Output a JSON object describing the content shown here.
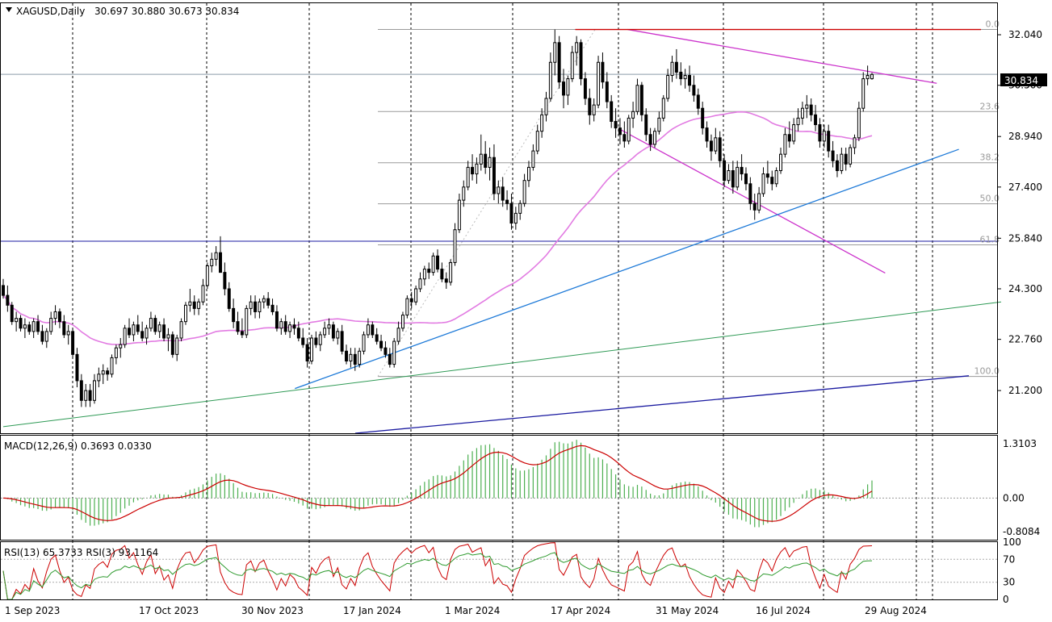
{
  "main_header": {
    "title": "XAGUSD,Daily",
    "ohlc": "30.697 30.880 30.673 30.834"
  },
  "macd_header": "MACD(12,26,9) 0.3693 0.0330",
  "rsi_header": "RSI(13) 65.3733  RSI(3) 93.1164",
  "price_box": "30.834",
  "colors": {
    "bull": "#000000",
    "ma": "#e27be2",
    "magenta_line": "#cc33cc",
    "red_line": "#cc0000",
    "blue_trend": "#1e7ad8",
    "green_trend": "#2e9a55",
    "navy_trend": "#1a1aa0",
    "macd_hist": "#4caf50",
    "macd_signal": "#cc0000",
    "rsi_fast": "#cc0000",
    "rsi_slow": "#2e9a2e"
  },
  "chart_data": [
    {
      "type": "candlestick",
      "symbol": "XAGUSD",
      "timeframe": "Daily",
      "x_ticks": [
        "1 Sep 2023",
        "17 Oct 2023",
        "30 Nov 2023",
        "17 Jan 2024",
        "1 Mar 2024",
        "17 Apr 2024",
        "31 May 2024",
        "16 Jul 2024",
        "29 Aug 2024"
      ],
      "y_ticks": [
        32.04,
        30.5,
        28.94,
        27.4,
        25.84,
        24.3,
        22.76,
        21.2
      ],
      "ylim": [
        19.9,
        33.0
      ],
      "last_price": 30.834,
      "fib_levels": [
        {
          "label": "0.0",
          "value": 32.2
        },
        {
          "label": "23.6",
          "value": 29.7
        },
        {
          "label": "38.2",
          "value": 28.14
        },
        {
          "label": "50.0",
          "value": 26.89
        },
        {
          "label": "61.8",
          "value": 25.64
        },
        {
          "label": "100.0",
          "value": 21.63
        }
      ],
      "trendlines": [
        {
          "name": "magenta-upper",
          "p1": {
            "date": "2024-05-20",
            "price": 32.2
          },
          "p2": {
            "date": "2024-09-18",
            "price": 30.56
          }
        },
        {
          "name": "magenta-lower",
          "p1": {
            "date": "2024-05-17",
            "price": 29.15
          },
          "p2": {
            "date": "2024-09-04",
            "price": 24.78
          }
        },
        {
          "name": "red-resistance",
          "p1": {
            "date": "2024-04-28",
            "price": 32.2
          },
          "p2": {
            "date": "2024-09-30",
            "price": 32.2
          }
        },
        {
          "name": "blue-support",
          "p1": {
            "date": "2023-12-26",
            "price": 21.26
          },
          "p2": {
            "date": "2024-09-24",
            "price": 28.55
          }
        }
      ],
      "ohlc": [
        [
          24.4,
          24.6,
          24.0,
          24.1
        ],
        [
          24.1,
          24.4,
          23.6,
          23.8
        ],
        [
          23.8,
          23.9,
          23.2,
          23.3
        ],
        [
          23.3,
          23.6,
          23.0,
          23.4
        ],
        [
          23.4,
          23.5,
          23.0,
          23.1
        ],
        [
          23.1,
          23.4,
          22.8,
          23.2
        ],
        [
          23.2,
          23.3,
          22.9,
          23.0
        ],
        [
          23.0,
          23.4,
          22.8,
          23.3
        ],
        [
          23.3,
          23.5,
          22.9,
          23.0
        ],
        [
          23.0,
          23.2,
          22.6,
          22.7
        ],
        [
          22.7,
          23.1,
          22.5,
          23.0
        ],
        [
          23.0,
          23.6,
          22.9,
          23.4
        ],
        [
          23.4,
          23.8,
          23.2,
          23.6
        ],
        [
          23.6,
          23.7,
          23.1,
          23.3
        ],
        [
          23.3,
          23.5,
          22.8,
          22.9
        ],
        [
          22.9,
          23.2,
          22.6,
          23.0
        ],
        [
          23.0,
          23.1,
          22.2,
          22.3
        ],
        [
          22.3,
          22.5,
          21.3,
          21.5
        ],
        [
          21.5,
          21.7,
          20.7,
          20.9
        ],
        [
          20.9,
          21.4,
          20.7,
          21.2
        ],
        [
          21.2,
          21.4,
          20.7,
          20.9
        ],
        [
          20.9,
          21.7,
          20.8,
          21.5
        ],
        [
          21.5,
          21.9,
          21.3,
          21.7
        ],
        [
          21.7,
          22.0,
          21.4,
          21.8
        ],
        [
          21.8,
          21.9,
          21.5,
          21.7
        ],
        [
          21.7,
          22.3,
          21.6,
          22.2
        ],
        [
          22.2,
          22.6,
          22.0,
          22.5
        ],
        [
          22.5,
          22.8,
          22.2,
          22.6
        ],
        [
          22.6,
          23.2,
          22.5,
          23.1
        ],
        [
          23.1,
          23.4,
          22.8,
          22.9
        ],
        [
          22.9,
          23.3,
          22.7,
          23.2
        ],
        [
          23.2,
          23.5,
          22.9,
          23.0
        ],
        [
          23.0,
          23.3,
          22.7,
          22.8
        ],
        [
          22.8,
          23.2,
          22.6,
          23.1
        ],
        [
          23.1,
          23.6,
          23.0,
          23.4
        ],
        [
          23.4,
          23.5,
          22.9,
          23.0
        ],
        [
          23.0,
          23.3,
          22.8,
          23.2
        ],
        [
          23.2,
          23.4,
          22.7,
          22.8
        ],
        [
          22.8,
          23.1,
          22.4,
          22.9
        ],
        [
          22.9,
          23.0,
          22.2,
          22.3
        ],
        [
          22.3,
          22.9,
          22.1,
          22.8
        ],
        [
          22.8,
          23.4,
          22.7,
          23.3
        ],
        [
          23.3,
          23.9,
          23.2,
          23.8
        ],
        [
          23.8,
          24.3,
          23.6,
          23.9
        ],
        [
          23.9,
          24.1,
          23.5,
          23.7
        ],
        [
          23.7,
          24.0,
          23.5,
          23.9
        ],
        [
          23.9,
          24.6,
          23.8,
          24.4
        ],
        [
          24.4,
          25.1,
          24.3,
          25.0
        ],
        [
          25.0,
          25.4,
          24.8,
          25.2
        ],
        [
          25.2,
          25.6,
          25.0,
          25.4
        ],
        [
          25.4,
          25.9,
          25.1,
          24.8
        ],
        [
          24.8,
          25.1,
          24.1,
          24.3
        ],
        [
          24.3,
          24.5,
          23.6,
          23.7
        ],
        [
          23.7,
          24.0,
          23.1,
          23.3
        ],
        [
          23.3,
          23.6,
          22.9,
          23.0
        ],
        [
          23.0,
          23.4,
          22.8,
          22.9
        ],
        [
          22.9,
          23.8,
          22.8,
          23.7
        ],
        [
          23.7,
          24.1,
          23.5,
          23.9
        ],
        [
          23.9,
          24.1,
          23.4,
          23.6
        ],
        [
          23.6,
          24.0,
          23.4,
          23.9
        ],
        [
          23.9,
          24.1,
          23.7,
          24.0
        ],
        [
          24.0,
          24.2,
          23.7,
          23.8
        ],
        [
          23.8,
          24.0,
          23.5,
          23.6
        ],
        [
          23.6,
          23.8,
          23.0,
          23.1
        ],
        [
          23.1,
          23.4,
          22.9,
          23.3
        ],
        [
          23.3,
          23.5,
          22.9,
          23.0
        ],
        [
          23.0,
          23.3,
          22.8,
          23.2
        ],
        [
          23.2,
          23.4,
          22.9,
          23.1
        ],
        [
          23.1,
          23.3,
          22.7,
          22.8
        ],
        [
          22.8,
          23.1,
          22.5,
          22.6
        ],
        [
          22.6,
          22.8,
          21.9,
          22.1
        ],
        [
          22.1,
          22.9,
          22.0,
          22.8
        ],
        [
          22.8,
          23.0,
          22.5,
          22.6
        ],
        [
          22.6,
          23.0,
          22.4,
          22.9
        ],
        [
          22.9,
          23.3,
          22.8,
          23.1
        ],
        [
          23.1,
          23.4,
          22.9,
          23.2
        ],
        [
          23.2,
          23.3,
          22.7,
          22.8
        ],
        [
          22.8,
          23.1,
          22.6,
          23.0
        ],
        [
          23.0,
          23.2,
          22.3,
          22.4
        ],
        [
          22.4,
          22.6,
          22.0,
          22.1
        ],
        [
          22.1,
          22.5,
          21.9,
          22.3
        ],
        [
          22.3,
          22.5,
          21.8,
          22.0
        ],
        [
          22.0,
          22.5,
          21.9,
          22.4
        ],
        [
          22.4,
          23.0,
          22.3,
          22.9
        ],
        [
          22.9,
          23.4,
          22.8,
          23.2
        ],
        [
          23.2,
          23.3,
          22.8,
          22.9
        ],
        [
          22.9,
          23.1,
          22.6,
          22.7
        ],
        [
          22.7,
          22.9,
          22.4,
          22.5
        ],
        [
          22.5,
          22.7,
          22.2,
          22.3
        ],
        [
          22.3,
          22.5,
          21.9,
          22.0
        ],
        [
          22.0,
          22.8,
          21.9,
          22.7
        ],
        [
          22.7,
          23.3,
          22.6,
          23.1
        ],
        [
          23.1,
          23.6,
          23.0,
          23.5
        ],
        [
          23.5,
          24.1,
          23.4,
          24.0
        ],
        [
          24.0,
          24.2,
          23.7,
          23.9
        ],
        [
          23.9,
          24.4,
          23.8,
          24.3
        ],
        [
          24.3,
          24.8,
          24.2,
          24.6
        ],
        [
          24.6,
          25.0,
          24.4,
          24.9
        ],
        [
          24.9,
          25.1,
          24.6,
          24.8
        ],
        [
          24.8,
          25.4,
          24.7,
          25.3
        ],
        [
          25.3,
          25.5,
          24.8,
          24.9
        ],
        [
          24.9,
          25.1,
          24.5,
          24.6
        ],
        [
          24.6,
          24.8,
          24.3,
          24.5
        ],
        [
          24.5,
          25.2,
          24.4,
          25.1
        ],
        [
          25.1,
          26.3,
          25.0,
          26.1
        ],
        [
          26.1,
          27.2,
          26.0,
          27.0
        ],
        [
          27.0,
          27.6,
          26.8,
          27.4
        ],
        [
          27.4,
          28.2,
          27.3,
          28.0
        ],
        [
          28.0,
          28.4,
          27.6,
          27.8
        ],
        [
          27.8,
          28.3,
          27.5,
          28.1
        ],
        [
          28.1,
          29.0,
          27.9,
          28.4
        ],
        [
          28.4,
          28.8,
          27.8,
          28.0
        ],
        [
          28.0,
          28.6,
          27.6,
          28.3
        ],
        [
          28.3,
          28.7,
          27.0,
          27.2
        ],
        [
          27.2,
          27.6,
          26.9,
          27.4
        ],
        [
          27.4,
          27.7,
          26.8,
          27.0
        ],
        [
          27.0,
          27.3,
          26.7,
          26.9
        ],
        [
          26.9,
          27.2,
          26.1,
          26.3
        ],
        [
          26.3,
          26.8,
          26.1,
          26.6
        ],
        [
          26.6,
          27.0,
          26.4,
          26.9
        ],
        [
          26.9,
          27.8,
          26.8,
          27.6
        ],
        [
          27.6,
          28.2,
          27.4,
          28.0
        ],
        [
          28.0,
          28.7,
          27.9,
          28.5
        ],
        [
          28.5,
          29.3,
          28.4,
          29.1
        ],
        [
          29.1,
          29.8,
          28.9,
          29.6
        ],
        [
          29.6,
          30.3,
          29.4,
          30.1
        ],
        [
          30.1,
          31.5,
          30.0,
          31.2
        ],
        [
          31.2,
          32.2,
          30.8,
          31.8
        ],
        [
          31.8,
          32.0,
          30.4,
          30.6
        ],
        [
          30.6,
          31.0,
          29.8,
          30.2
        ],
        [
          30.2,
          30.8,
          29.9,
          30.7
        ],
        [
          30.7,
          31.7,
          30.6,
          31.5
        ],
        [
          31.5,
          32.0,
          31.1,
          31.8
        ],
        [
          31.8,
          31.9,
          30.5,
          30.7
        ],
        [
          30.7,
          30.9,
          29.9,
          30.1
        ],
        [
          30.1,
          30.4,
          29.3,
          29.6
        ],
        [
          29.6,
          30.1,
          29.4,
          29.9
        ],
        [
          29.9,
          31.4,
          29.8,
          31.2
        ],
        [
          31.2,
          31.5,
          30.4,
          30.6
        ],
        [
          30.6,
          30.9,
          29.8,
          30.0
        ],
        [
          30.0,
          30.2,
          29.2,
          29.4
        ],
        [
          29.4,
          29.8,
          28.9,
          29.2
        ],
        [
          29.2,
          29.5,
          28.7,
          29.0
        ],
        [
          29.0,
          29.4,
          28.6,
          28.8
        ],
        [
          28.8,
          29.6,
          28.7,
          29.5
        ],
        [
          29.5,
          30.0,
          29.2,
          29.7
        ],
        [
          29.7,
          30.7,
          29.6,
          30.5
        ],
        [
          30.5,
          30.6,
          29.4,
          29.6
        ],
        [
          29.6,
          29.8,
          28.8,
          29.0
        ],
        [
          29.0,
          29.2,
          28.5,
          28.7
        ],
        [
          28.7,
          29.2,
          28.6,
          29.1
        ],
        [
          29.1,
          29.7,
          29.0,
          29.5
        ],
        [
          29.5,
          30.2,
          29.4,
          30.1
        ],
        [
          30.1,
          31.0,
          30.0,
          30.8
        ],
        [
          30.8,
          31.4,
          30.6,
          31.2
        ],
        [
          31.2,
          31.6,
          30.7,
          30.9
        ],
        [
          30.9,
          31.2,
          30.5,
          30.7
        ],
        [
          30.7,
          31.0,
          30.4,
          30.8
        ],
        [
          30.8,
          31.1,
          30.3,
          30.5
        ],
        [
          30.5,
          30.8,
          30.0,
          30.2
        ],
        [
          30.2,
          30.4,
          29.6,
          29.8
        ],
        [
          29.8,
          30.0,
          29.0,
          29.2
        ],
        [
          29.2,
          29.4,
          28.6,
          28.8
        ],
        [
          28.8,
          29.0,
          28.2,
          28.5
        ],
        [
          28.5,
          29.2,
          28.4,
          28.9
        ],
        [
          28.9,
          29.1,
          28.0,
          28.2
        ],
        [
          28.2,
          28.4,
          27.4,
          27.6
        ],
        [
          27.6,
          28.1,
          27.5,
          27.9
        ],
        [
          27.9,
          28.2,
          27.2,
          27.4
        ],
        [
          27.4,
          28.2,
          27.3,
          28.0
        ],
        [
          28.0,
          28.4,
          27.6,
          27.8
        ],
        [
          27.8,
          28.0,
          27.3,
          27.5
        ],
        [
          27.5,
          27.7,
          26.7,
          26.9
        ],
        [
          26.9,
          27.2,
          26.4,
          26.7
        ],
        [
          26.7,
          27.4,
          26.6,
          27.2
        ],
        [
          27.2,
          28.0,
          27.1,
          27.8
        ],
        [
          27.8,
          28.2,
          27.5,
          27.7
        ],
        [
          27.7,
          27.9,
          27.3,
          27.5
        ],
        [
          27.5,
          28.0,
          27.4,
          27.9
        ],
        [
          27.9,
          28.6,
          27.8,
          28.4
        ],
        [
          28.4,
          29.2,
          28.3,
          29.0
        ],
        [
          29.0,
          29.4,
          28.6,
          28.8
        ],
        [
          28.8,
          29.5,
          28.7,
          29.3
        ],
        [
          29.3,
          29.8,
          29.1,
          29.5
        ],
        [
          29.5,
          30.0,
          29.3,
          29.8
        ],
        [
          29.8,
          30.2,
          29.5,
          29.9
        ],
        [
          29.9,
          30.1,
          29.4,
          29.6
        ],
        [
          29.6,
          29.9,
          29.1,
          29.3
        ],
        [
          29.3,
          29.5,
          28.6,
          28.8
        ],
        [
          28.8,
          29.3,
          28.6,
          29.1
        ],
        [
          29.1,
          29.3,
          28.3,
          28.5
        ],
        [
          28.5,
          28.8,
          28.0,
          28.2
        ],
        [
          28.2,
          28.4,
          27.7,
          27.9
        ],
        [
          27.9,
          28.6,
          27.8,
          28.4
        ],
        [
          28.4,
          28.6,
          27.9,
          28.1
        ],
        [
          28.1,
          28.7,
          28.0,
          28.6
        ],
        [
          28.6,
          29.0,
          28.4,
          28.9
        ],
        [
          28.9,
          30.0,
          28.8,
          29.8
        ],
        [
          29.8,
          30.9,
          29.7,
          30.7
        ],
        [
          30.7,
          31.1,
          30.5,
          30.8
        ],
        [
          30.7,
          30.88,
          30.67,
          30.83
        ]
      ]
    },
    {
      "type": "macd",
      "params": "12,26,9",
      "y_ticks": [
        1.3103,
        0.0,
        -0.8084
      ],
      "ylim": [
        -1.0,
        1.5
      ]
    },
    {
      "type": "rsi",
      "params": [
        "13",
        "3"
      ],
      "y_ticks": [
        100,
        70,
        30,
        0
      ],
      "ylim": [
        0,
        100
      ]
    }
  ]
}
